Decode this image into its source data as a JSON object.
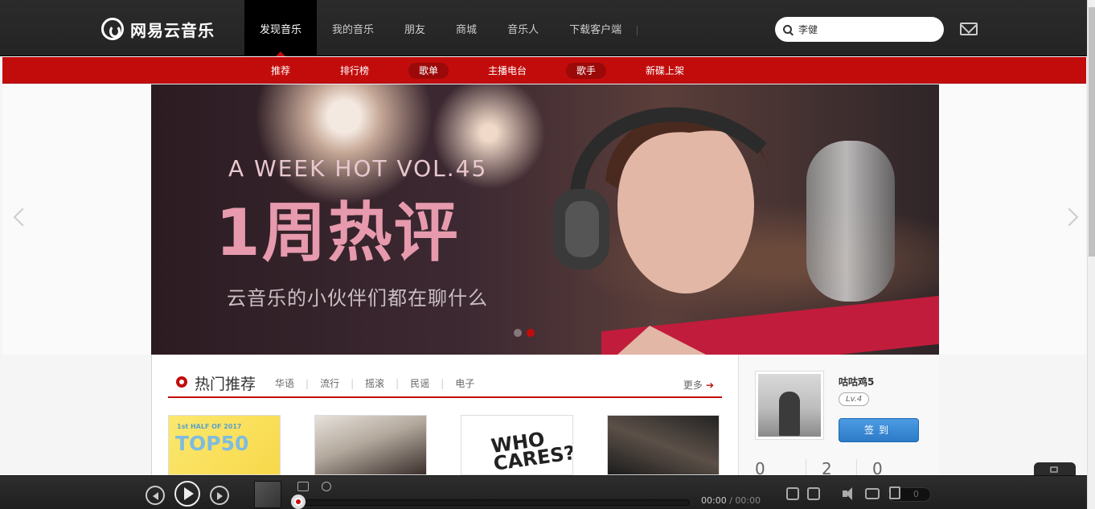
{
  "header": {
    "logo_text": "网易云音乐",
    "tabs": [
      {
        "label": "发现音乐"
      },
      {
        "label": "我的音乐"
      },
      {
        "label": "朋友"
      },
      {
        "label": "商城"
      },
      {
        "label": "音乐人"
      },
      {
        "label": "下载客户端"
      }
    ],
    "search": {
      "value": "李健"
    }
  },
  "subnav": {
    "items": [
      {
        "label": "推荐"
      },
      {
        "label": "排行榜"
      },
      {
        "label": "歌单"
      },
      {
        "label": "主播电台"
      },
      {
        "label": "歌手"
      },
      {
        "label": "新碟上架"
      }
    ]
  },
  "banner": {
    "headline_en": "A WEEK HOT VOL.45",
    "headline_cn": "1周热评",
    "subtitle": "云音乐的小伙伴们都在聊什么"
  },
  "hot": {
    "title": "热门推荐",
    "tags": [
      "华语",
      "流行",
      "摇滚",
      "民谣",
      "电子"
    ],
    "more": "更多",
    "cards": [
      {
        "text_small": "1st HALF OF 2017",
        "text_big": "TOP50"
      },
      {},
      {
        "text": "WHO CARES?"
      },
      {}
    ]
  },
  "user": {
    "name": "咕咕鸡5",
    "level": "Lv.4",
    "checkin": "签到",
    "stats": [
      "0",
      "2",
      "0"
    ]
  },
  "player": {
    "time_current": "00:00",
    "time_sep": " / ",
    "time_total": "00:00",
    "playlist_count": "0",
    "progress": 0
  },
  "colors": {
    "brand_red": "#c20c0c",
    "topbar": "#242424",
    "checkin_blue": "#2d7bc8"
  }
}
